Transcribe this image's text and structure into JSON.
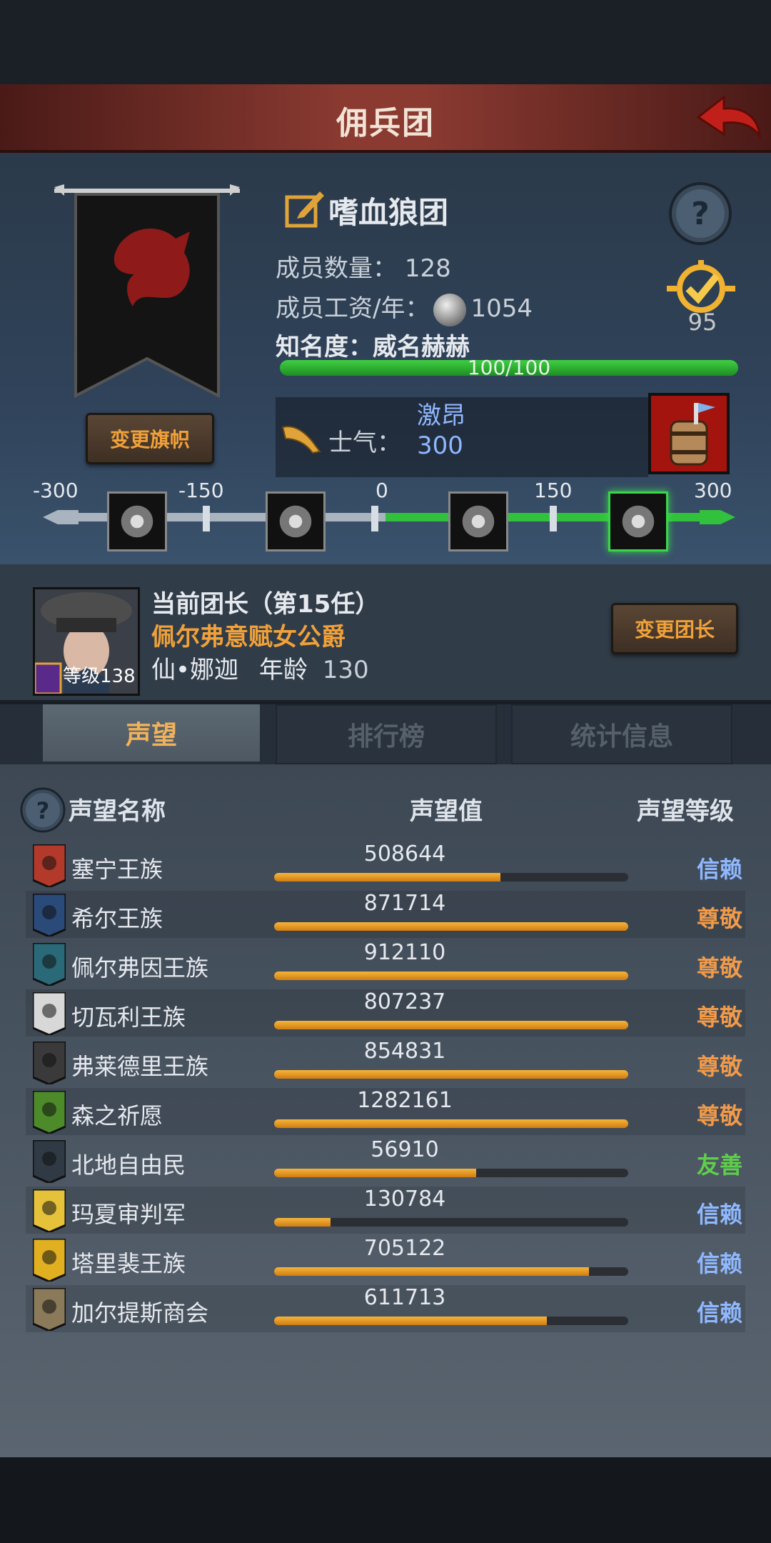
{
  "title": "佣兵团",
  "guild": {
    "name": "嗜血狼团",
    "members_label": "成员数量：",
    "members_value": "128",
    "wage_label": "成员工资/年：",
    "wage_value": "1054",
    "fame_label": "知名度：",
    "fame_rank": "威名赫赫",
    "fame_progress_text": "100/100",
    "fame_progress": 1.0,
    "rank_number": "95",
    "change_banner_label": "变更旗帜",
    "morale_label": "士气：",
    "morale_word": "激昂",
    "morale_value": "300"
  },
  "morale_scale": {
    "ticks": [
      "-300",
      "-150",
      "0",
      "150",
      "300"
    ],
    "icons": [
      "eye-icon",
      "despair-icon",
      "calm-icon",
      "banner-cheer-icon"
    ],
    "active_index": 3,
    "current_value": 300
  },
  "leader": {
    "title": "当前团长（第15任）",
    "name": "佩尔弗意赋女公爵",
    "race_name": "仙•娜迦",
    "age_label": "年龄",
    "age_value": "130",
    "level_text": "等级138",
    "change_leader_label": "变更团长"
  },
  "tabs": [
    {
      "label": "声望",
      "active": true
    },
    {
      "label": "排行榜",
      "active": false
    },
    {
      "label": "统计信息",
      "active": false
    }
  ],
  "list": {
    "headers": {
      "name": "声望名称",
      "value": "声望值",
      "grade": "声望等级"
    },
    "rows": [
      {
        "name": "塞宁王族",
        "value": "508644",
        "fill": 0.64,
        "grade": "信赖",
        "grade_color": "#8fb8ff",
        "icon_color": "#b33a2a",
        "icon": "tree-crest-icon"
      },
      {
        "name": "希尔王族",
        "value": "871714",
        "fill": 1.0,
        "grade": "尊敬",
        "grade_color": "#f09a4a",
        "icon_color": "#2a4a7a",
        "icon": "helmet-crest-icon"
      },
      {
        "name": "佩尔弗因王族",
        "value": "912110",
        "fill": 1.0,
        "grade": "尊敬",
        "grade_color": "#f09a4a",
        "icon_color": "#2a6a78",
        "icon": "moon-crest-icon"
      },
      {
        "name": "切瓦利王族",
        "value": "807237",
        "fill": 1.0,
        "grade": "尊敬",
        "grade_color": "#f09a4a",
        "icon_color": "#d8d8d8",
        "icon": "scales-crest-icon"
      },
      {
        "name": "弗莱德里王族",
        "value": "854831",
        "fill": 1.0,
        "grade": "尊敬",
        "grade_color": "#f09a4a",
        "icon_color": "#3a3a3a",
        "icon": "sword-crest-icon"
      },
      {
        "name": "森之祈愿",
        "value": "1282161",
        "fill": 1.0,
        "grade": "尊敬",
        "grade_color": "#f09a4a",
        "icon_color": "#4d8a2a",
        "icon": "leaf-crest-icon"
      },
      {
        "name": "北地自由民",
        "value": "56910",
        "fill": 0.57,
        "grade": "友善",
        "grade_color": "#5fcf4a",
        "icon_color": "#2f3a44",
        "icon": "axe-crest-icon"
      },
      {
        "name": "玛夏审判军",
        "value": "130784",
        "fill": 0.16,
        "grade": "信赖",
        "grade_color": "#8fb8ff",
        "icon_color": "#e6c23a",
        "icon": "sun-crest-icon"
      },
      {
        "name": "塔里裴王族",
        "value": "705122",
        "fill": 0.89,
        "grade": "信赖",
        "grade_color": "#8fb8ff",
        "icon_color": "#e0b020",
        "icon": "crown-crest-icon"
      },
      {
        "name": "加尔提斯商会",
        "value": "611713",
        "fill": 0.77,
        "grade": "信赖",
        "grade_color": "#8fb8ff",
        "icon_color": "#8a7a5a",
        "icon": "coin-crest-icon"
      }
    ]
  }
}
